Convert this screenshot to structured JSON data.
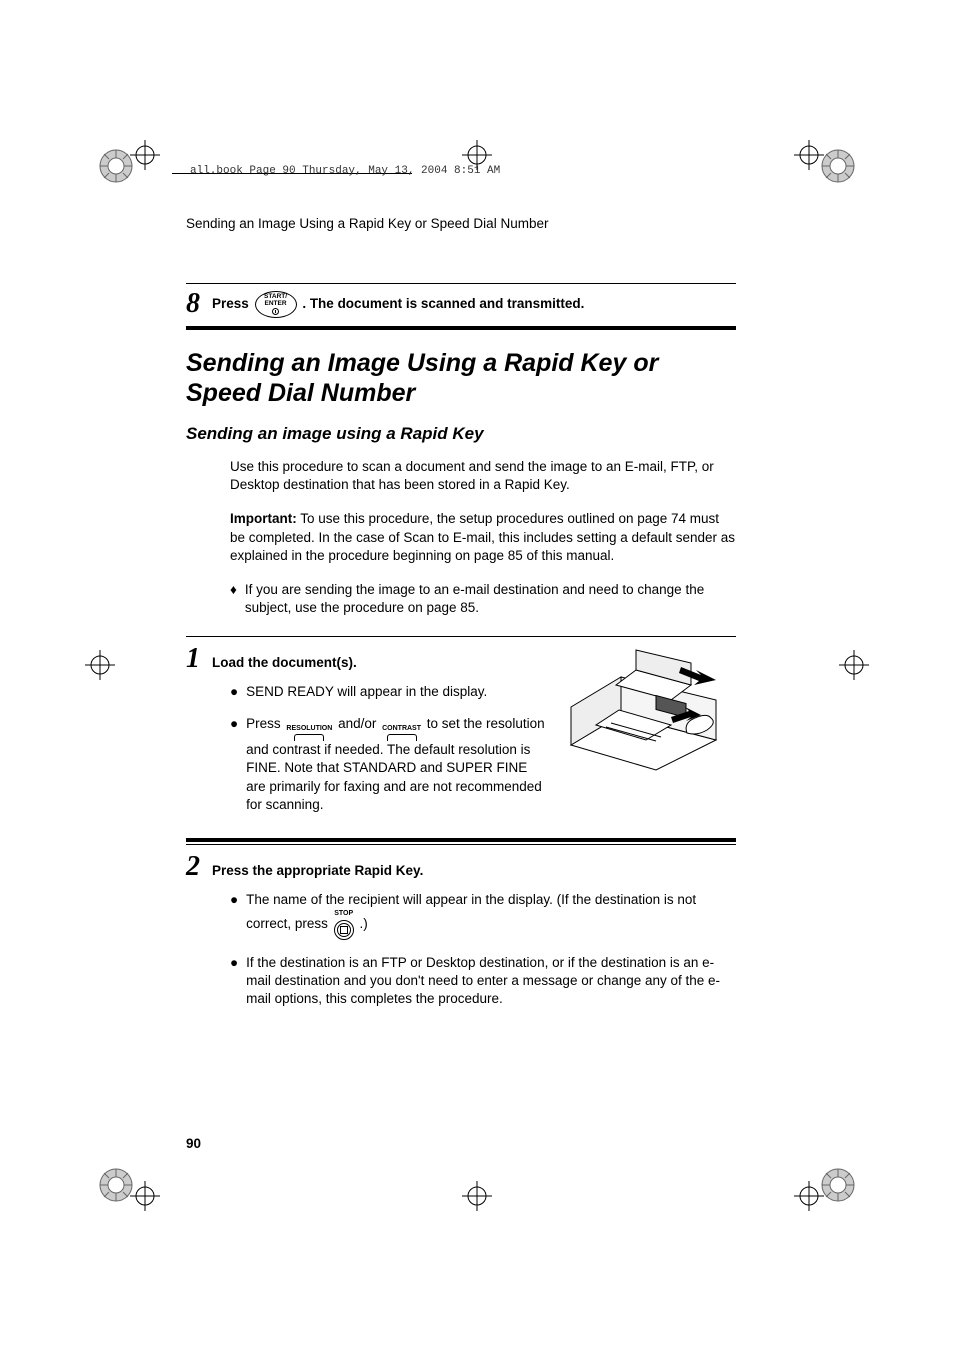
{
  "header": {
    "crop_text": "all.book  Page 90  Thursday, May 13, 2004  8:51 AM",
    "running_head": "Sending an Image Using a Rapid Key or Speed Dial Number"
  },
  "step8": {
    "num": "8",
    "text_before": "Press ",
    "button_line1": "START/",
    "button_line2": "ENTER",
    "text_after": ". The document is scanned and transmitted."
  },
  "title": "Sending an Image Using a Rapid Key or Speed Dial Number",
  "subtitle": "Sending an image using a Rapid Key",
  "intro": "Use this procedure to scan a document and send the image to an E-mail, FTP, or Desktop destination that has been stored in a Rapid Key.",
  "important_label": "Important:",
  "important": " To use this procedure, the setup procedures outlined on page 74 must be completed. In the case of Scan to E-mail, this includes setting a default sender as explained in the procedure beginning on page 85 of this manual.",
  "diamond_note": "If you are sending the image to an e-mail destination and need to change the subject, use the procedure on page 85.",
  "step1": {
    "num": "1",
    "heading": "Load the document(s).",
    "bullet1": "SEND READY will appear in the display.",
    "bullet2_a": "Press ",
    "key_res": "RESOLUTION",
    "bullet2_b": " and/or ",
    "key_con": "CONTRAST",
    "bullet2_c": " to set the resolution and contrast if needed. The default resolution is FINE. Note that STANDARD and SUPER FINE are primarily for faxing and are not recommended for scanning."
  },
  "step2": {
    "num": "2",
    "heading": "Press the appropriate Rapid Key.",
    "bullet1_a": "The name of the recipient will appear in the display. (If the destination is not correct, press ",
    "stop_label": "STOP",
    "bullet1_b": " .)",
    "bullet2": "If the destination is an FTP or Desktop destination, or if the destination is an e-mail destination and you don't need to enter a message or change any of the e-mail options, this completes the procedure."
  },
  "page_number": "90"
}
